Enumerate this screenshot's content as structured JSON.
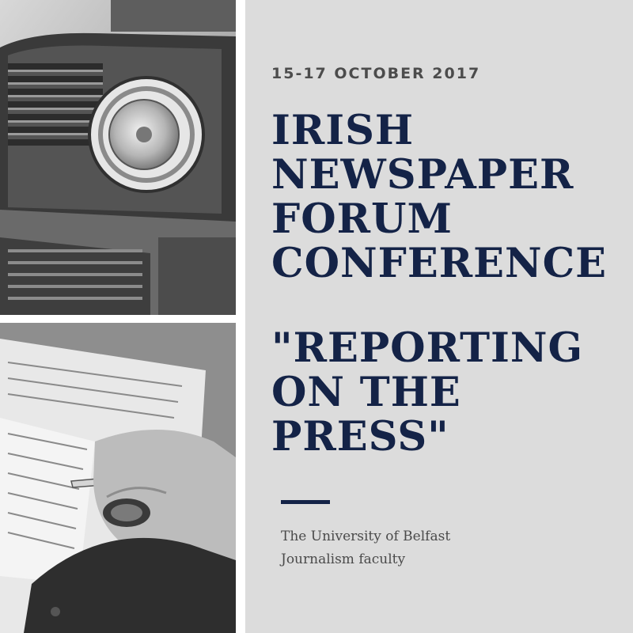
{
  "event": {
    "date": "15-17 OCTOBER 2017",
    "title_lines": [
      "IRISH",
      "NEWSPAPER",
      "FORUM",
      "CONFERENCE"
    ],
    "subtitle_lines": [
      "\"REPORTING",
      "ON THE",
      "PRESS\""
    ],
    "host_lines": [
      "The University of Belfast",
      "Journalism faculty"
    ]
  },
  "colors": {
    "navy": "#142347",
    "panel": "#dcdcdc",
    "date_text": "#4c4c4c"
  },
  "images": {
    "top": "vintage-radio-photo",
    "bottom": "hand-writing-notes-photo"
  }
}
